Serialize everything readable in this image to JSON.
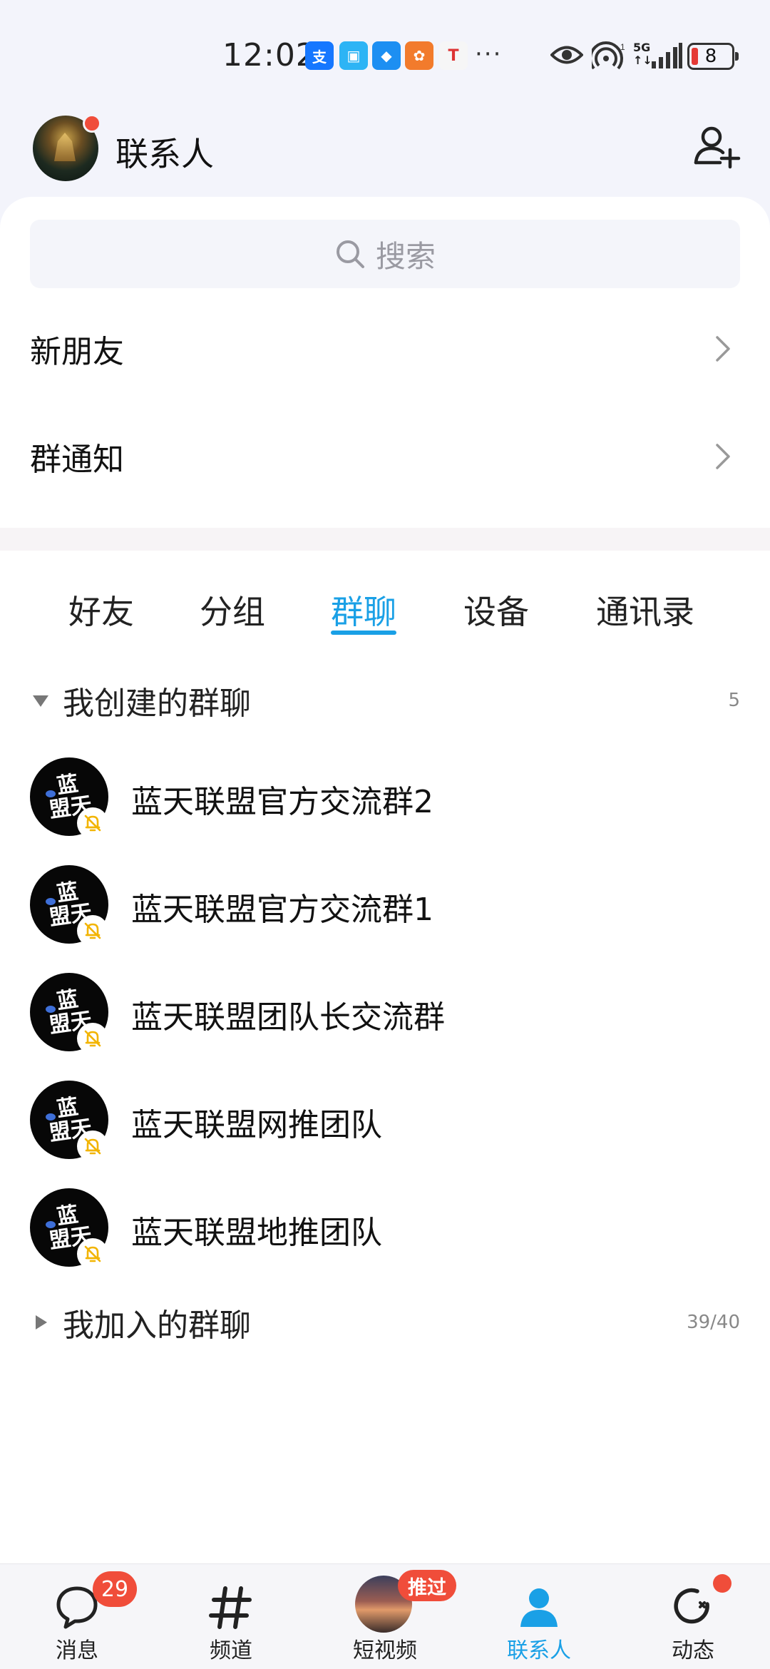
{
  "status_bar": {
    "time": "12:02",
    "more": "···",
    "network": "5G",
    "battery": "8",
    "app_icons": [
      {
        "name": "alipay-icon",
        "color": "#1677ff",
        "glyph": "支"
      },
      {
        "name": "app-icon-2",
        "color": "#2db4f5",
        "glyph": "▣"
      },
      {
        "name": "app-icon-3",
        "color": "#1d8ff2",
        "glyph": "◆"
      },
      {
        "name": "app-icon-4",
        "color": "#f27b2c",
        "glyph": "✿"
      },
      {
        "name": "shirt-icon",
        "color": "#f6f6f6",
        "glyph": "👕"
      }
    ]
  },
  "header": {
    "title": "联系人",
    "add_contact_icon": "add-user-icon"
  },
  "search": {
    "placeholder": "搜索"
  },
  "menu": {
    "new_friends": "新朋友",
    "group_notice": "群通知"
  },
  "tabs": [
    {
      "label": "好友",
      "active": false
    },
    {
      "label": "分组",
      "active": false
    },
    {
      "label": "群聊",
      "active": true
    },
    {
      "label": "设备",
      "active": false
    },
    {
      "label": "通讯录",
      "active": false
    }
  ],
  "created_groups": {
    "title": "我创建的群聊",
    "count": "5",
    "expanded": true,
    "items": [
      {
        "name": "蓝天联盟官方交流群2",
        "muted": true
      },
      {
        "name": "蓝天联盟官方交流群1",
        "muted": true
      },
      {
        "name": "蓝天联盟团队长交流群",
        "muted": true
      },
      {
        "name": "蓝天联盟网推团队",
        "muted": true
      },
      {
        "name": "蓝天联盟地推团队",
        "muted": true
      }
    ],
    "avatar_text_top": "蓝",
    "avatar_text_bottom": "盟天"
  },
  "joined_groups": {
    "title": "我加入的群聊",
    "count": "39/40",
    "expanded": false
  },
  "bottom_nav": [
    {
      "label": "消息",
      "badge": "29",
      "icon": "chat-bubble-icon"
    },
    {
      "label": "频道",
      "icon": "hashtag-icon"
    },
    {
      "label": "短视频",
      "badge": "推过",
      "icon": "video-thumbnail-icon"
    },
    {
      "label": "联系人",
      "icon": "contact-person-icon",
      "active": true
    },
    {
      "label": "动态",
      "icon": "refresh-star-icon",
      "dot": true
    }
  ],
  "colors": {
    "accent": "#1aa0e6",
    "badge": "#f04d3a",
    "mute": "#f2b400"
  }
}
